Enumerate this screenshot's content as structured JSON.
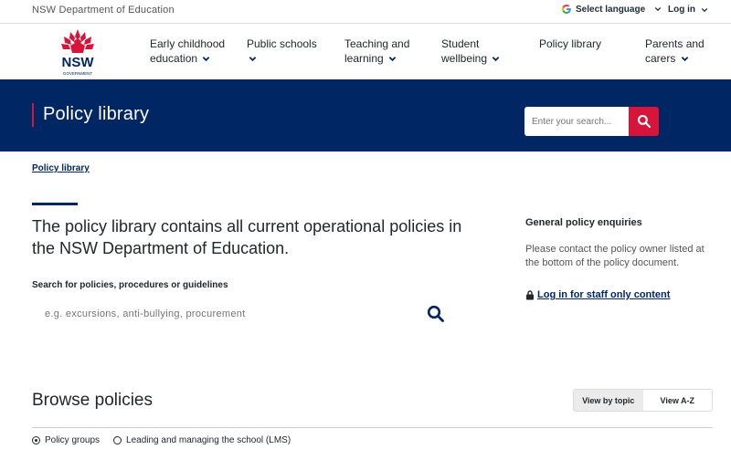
{
  "utility": {
    "org_name": "NSW Department of Education",
    "language_label": "Select language",
    "login_label": "Log in"
  },
  "logo": {
    "text": "NSW",
    "subtext": "GOVERNMENT"
  },
  "nav": {
    "items": [
      {
        "line1": "Early childhood",
        "line2": "education"
      },
      {
        "line1": "Public schools",
        "line2": ""
      },
      {
        "line1": "Teaching and",
        "line2": "learning"
      },
      {
        "line1": "Student",
        "line2": "wellbeing"
      },
      {
        "line1": "Policy library",
        "line2": ""
      },
      {
        "line1": "Parents and",
        "line2": "carers"
      }
    ]
  },
  "banner": {
    "title": "Policy library",
    "search_placeholder": "Enter your search..."
  },
  "breadcrumb": {
    "label": "Policy library"
  },
  "intro": {
    "heading": "The policy library contains all current operational policies in the NSW Department of Education.",
    "search_label": "Search for policies, procedures or guidelines",
    "search_placeholder": "e.g. excursions, anti-bullying, procurement"
  },
  "sidebar": {
    "title": "General policy enquiries",
    "text": "Please contact the policy owner listed at the bottom of the policy document.",
    "login_link": "Log in for staff only content"
  },
  "browse": {
    "title": "Browse policies",
    "view_by_topic": "View by topic",
    "view_az": "View A-Z",
    "radio_options": [
      {
        "label": "Policy groups",
        "checked": true
      },
      {
        "label": "Leading and managing the school (LMS)",
        "checked": false
      }
    ]
  },
  "colors": {
    "navy": "#002664",
    "red": "#d7153a"
  }
}
